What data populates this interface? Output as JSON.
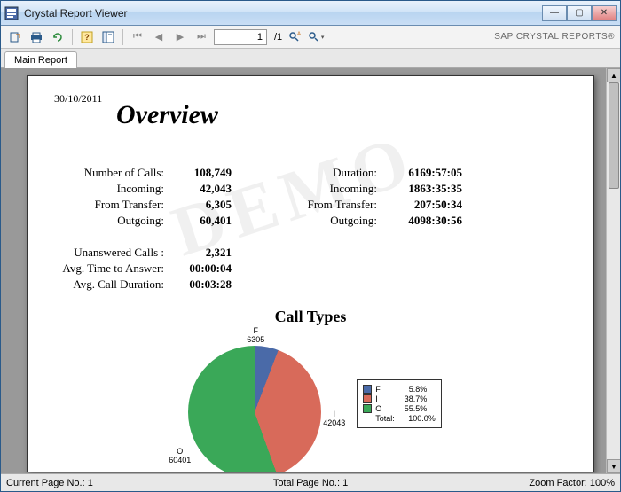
{
  "window": {
    "title": "Crystal Report Viewer"
  },
  "toolbar": {
    "page_value": "1",
    "page_total": "/1",
    "brand": "SAP CRYSTAL REPORTS®"
  },
  "tabs": {
    "main": "Main Report"
  },
  "report": {
    "date": "30/10/2011",
    "title": "Overview",
    "watermark": "DEMO",
    "left_rows": [
      {
        "label": "Number of Calls:",
        "value": "108,749"
      },
      {
        "label": "Incoming:",
        "value": "42,043"
      },
      {
        "label": "From Transfer:",
        "value": "6,305"
      },
      {
        "label": "Outgoing:",
        "value": "60,401"
      }
    ],
    "right_rows": [
      {
        "label": "Duration:",
        "value": "6169:57:05"
      },
      {
        "label": "Incoming:",
        "value": "1863:35:35"
      },
      {
        "label": "From Transfer:",
        "value": "207:50:34"
      },
      {
        "label": "Outgoing:",
        "value": "4098:30:56"
      }
    ],
    "bottom_rows": [
      {
        "label": "Unanswered Calls :",
        "value": "2,321"
      },
      {
        "label": "Avg. Time to Answer:",
        "value": "00:00:04"
      },
      {
        "label": "Avg. Call Duration:",
        "value": "00:03:28"
      }
    ],
    "chart_title": "Call Types"
  },
  "chart_data": {
    "type": "pie",
    "title": "Call Types",
    "series": [
      {
        "name": "F",
        "value": 6305,
        "pct": 5.8,
        "color": "#4a6aa8"
      },
      {
        "name": "I",
        "value": 42043,
        "pct": 38.7,
        "color": "#d86a5a"
      },
      {
        "name": "O",
        "value": 60401,
        "pct": 55.5,
        "color": "#3aa858"
      }
    ],
    "total_label": "Total:",
    "total_pct": "100.0%",
    "slice_labels": [
      {
        "text_a": "F",
        "text_b": "6305"
      },
      {
        "text_a": "I",
        "text_b": "42043"
      },
      {
        "text_a": "O",
        "text_b": "60401"
      }
    ]
  },
  "status": {
    "current": "Current Page No.: 1",
    "total": "Total Page No.: 1",
    "zoom": "Zoom Factor: 100%"
  }
}
